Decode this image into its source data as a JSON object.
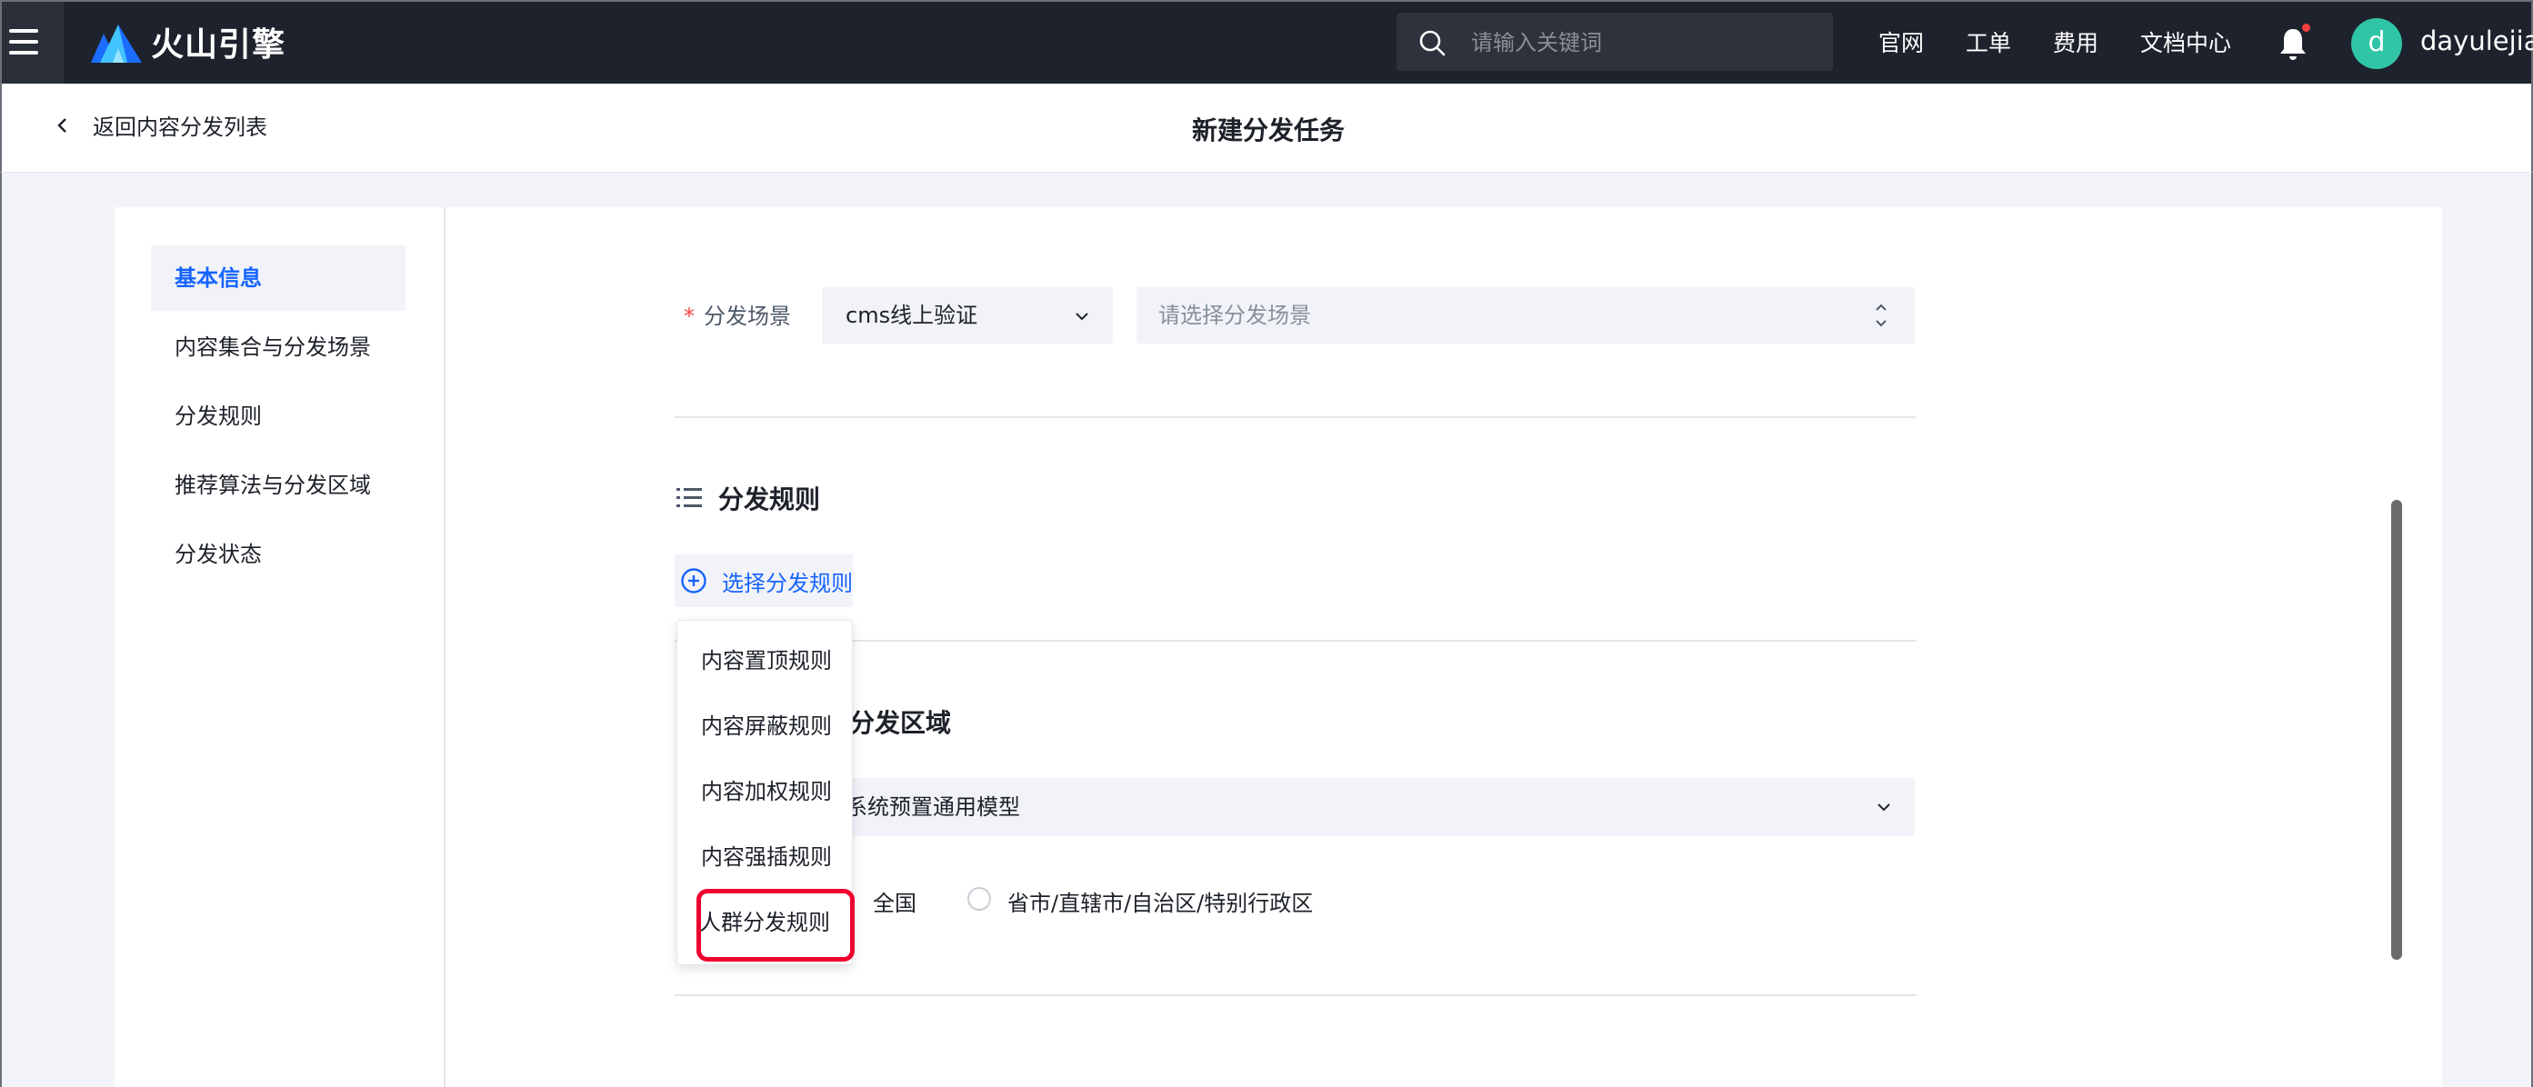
{
  "topbar": {
    "logo_text": "火山引擎",
    "search_placeholder": "请输入关键词",
    "nav": [
      "官网",
      "工单",
      "费用",
      "文档中心"
    ],
    "avatar_initial": "d",
    "username": "dayulejia",
    "icons": [
      "menu-icon",
      "volcano-logo-icon",
      "search-icon",
      "bell-icon"
    ]
  },
  "subheader": {
    "back_label": "返回内容分发列表",
    "title": "新建分发任务"
  },
  "sidebar": {
    "items": [
      {
        "label": "基本信息",
        "active": true
      },
      {
        "label": "内容集合与分发场景",
        "active": false
      },
      {
        "label": "分发规则",
        "active": false
      },
      {
        "label": "推荐算法与分发区域",
        "active": false
      },
      {
        "label": "分发状态",
        "active": false
      }
    ]
  },
  "scene": {
    "label": "分发场景",
    "required_mark": "*",
    "selected": "cms线上验证",
    "placeholder": "请选择分发场景"
  },
  "rules": {
    "title": "分发规则",
    "add_label": "选择分发规则",
    "dropdown": [
      "内容置顶规则",
      "内容屏蔽规则",
      "内容加权规则",
      "内容强插规则",
      "人群分发规则"
    ],
    "highlighted_item": "人群分发规则"
  },
  "algo": {
    "title_visible": "分发区域",
    "model_visible": "系统预置通用模型",
    "region_options": [
      "全国",
      "省市/直辖市/自治区/特别行政区"
    ]
  },
  "colors": {
    "topbar_bg": "#1e222d",
    "accent": "#1664ff",
    "highlight_border": "#f0002f",
    "avatar_bg": "#2fc5a6"
  }
}
